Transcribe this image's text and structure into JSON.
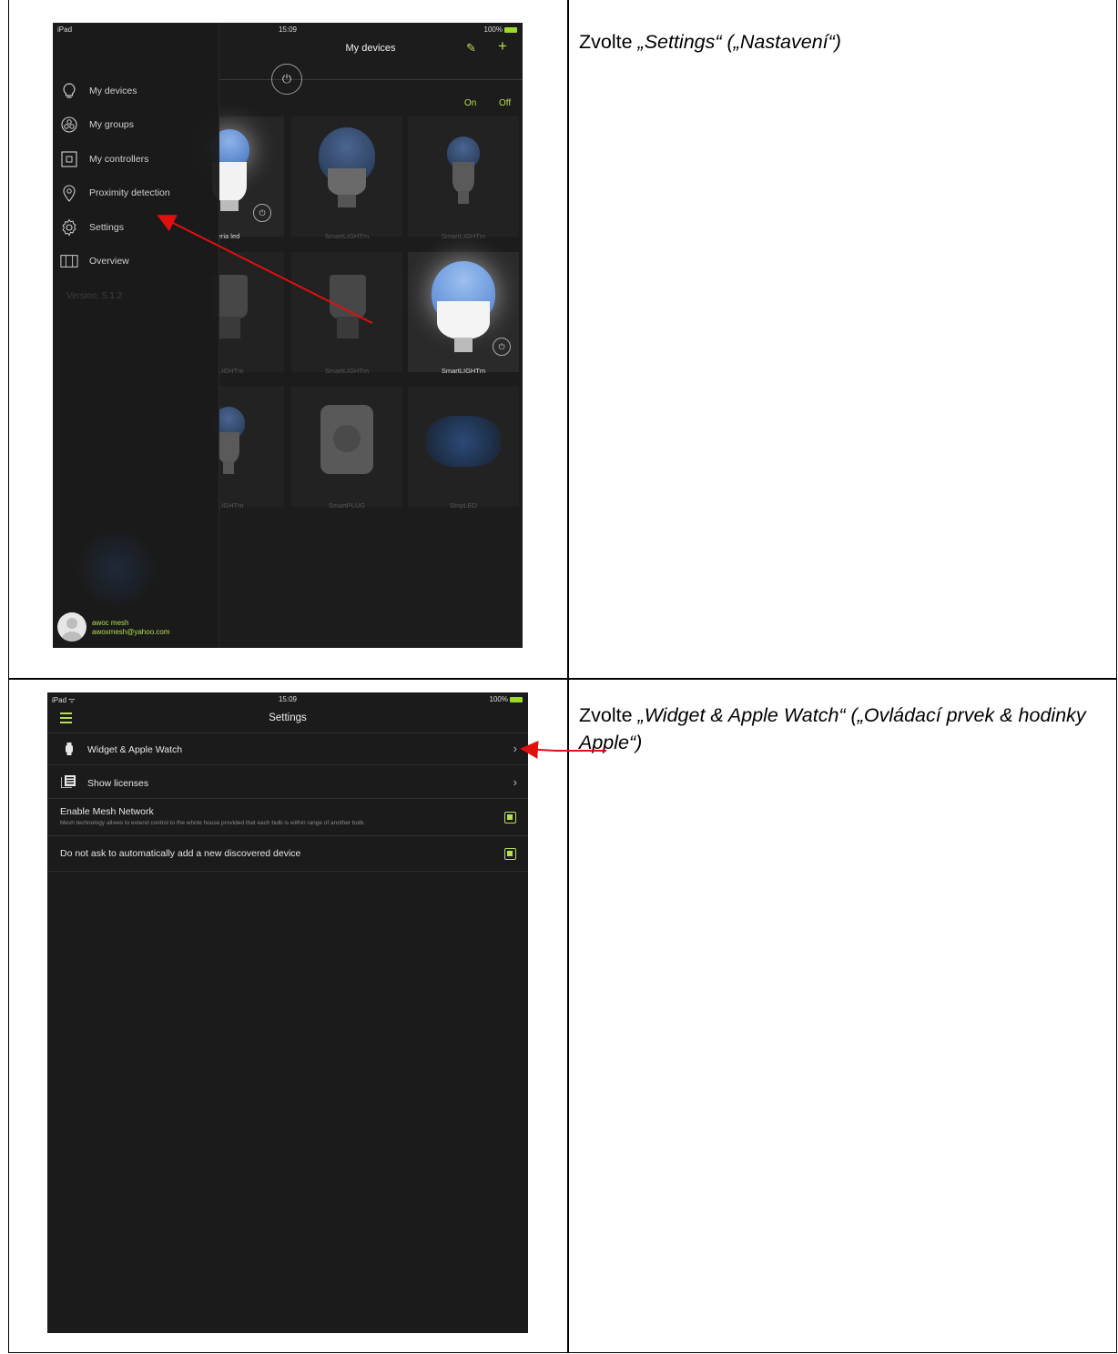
{
  "row1": {
    "caption_prefix": "Zvolte ",
    "caption_em": "„Settings“ („Nastavení“)",
    "screenshot": {
      "status": {
        "carrier": "iPad",
        "time": "15:09",
        "battery": "100%"
      },
      "title": "My devices",
      "on_label": "On",
      "off_label": "Off",
      "drawer": {
        "items": [
          {
            "label": "My devices",
            "icon": "lightbulb-icon"
          },
          {
            "label": "My groups",
            "icon": "groups-icon"
          },
          {
            "label": "My controllers",
            "icon": "controller-icon"
          },
          {
            "label": "Proximity detection",
            "icon": "location-pin-icon"
          },
          {
            "label": "Settings",
            "icon": "gear-icon"
          },
          {
            "label": "Overview",
            "icon": "map-icon"
          }
        ],
        "version": "Version: 5.1.2",
        "user_name": "awoc mesh",
        "user_email": "awoxmesh@yahoo.com"
      },
      "tiles": [
        {
          "label": "eria led",
          "bright": true
        },
        {
          "label": "SmartLIGHTm",
          "bright": false
        },
        {
          "label": "SmartLIGHTm",
          "bright": false
        },
        {
          "label": "rtLIGHTm",
          "bright": false
        },
        {
          "label": "SmartLIGHTm",
          "bright": false
        },
        {
          "label": "SmartLIGHTm",
          "bright": true
        },
        {
          "label": "rtLIGHTm",
          "bright": false
        },
        {
          "label": "SmartPLUG",
          "bright": false
        },
        {
          "label": "StripLED",
          "bright": false
        }
      ],
      "arrow_color": "#e01010"
    }
  },
  "row2": {
    "caption_prefix": "Zvolte ",
    "caption_em": "„Widget & Apple Watch“ („Ovládací prvek & hodinky Apple“)",
    "screenshot": {
      "status": {
        "carrier": "iPad",
        "time": "15:09",
        "battery": "100%"
      },
      "title": "Settings",
      "rows": [
        {
          "label": "Widget & Apple Watch",
          "icon": "watch-icon"
        },
        {
          "label": "Show licenses",
          "icon": "licenses-icon"
        },
        {
          "label": "Enable Mesh Network",
          "sub": "Mesh technology allows to extend control to the whole house provided that each bulb is within range of another bulb.",
          "checked": true
        },
        {
          "label": "Do not ask to automatically add a new discovered device",
          "checked": true
        }
      ]
    }
  },
  "accent_color": "#b8de52"
}
